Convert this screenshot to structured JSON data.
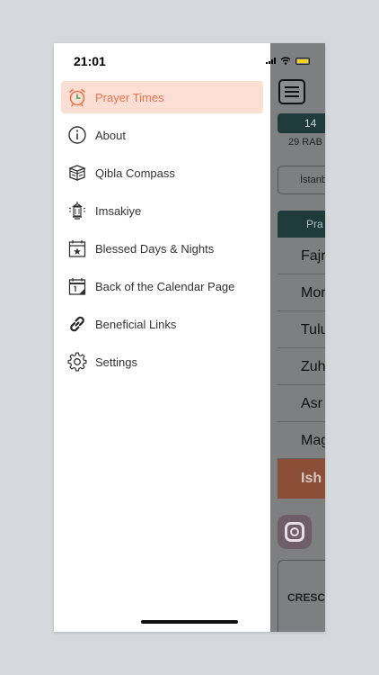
{
  "status_bar": {
    "time": "21:01"
  },
  "background_app": {
    "date": "14",
    "hijri_date": "29 RAB",
    "city": "İstanb",
    "table_header": "Pra",
    "rows": [
      "Fajr",
      "Mor",
      "Tulu",
      "Zuh",
      "Asr",
      "Mag",
      "Ish"
    ],
    "card_text": "CRESC"
  },
  "drawer": {
    "items": [
      {
        "label": "Prayer Times",
        "icon": "alarm-clock-icon",
        "selected": true
      },
      {
        "label": "About",
        "icon": "info-icon"
      },
      {
        "label": "Qibla Compass",
        "icon": "kaaba-icon"
      },
      {
        "label": "Imsakiye",
        "icon": "lantern-icon"
      },
      {
        "label": "Blessed Days & Nights",
        "icon": "calendar-star-icon"
      },
      {
        "label": "Back of the Calendar Page",
        "icon": "calendar-page-icon"
      },
      {
        "label": "Beneficial Links",
        "icon": "link-icon"
      },
      {
        "label": "Settings",
        "icon": "gear-icon"
      }
    ]
  },
  "colors": {
    "accent": "#e8754e",
    "selected_bg": "#fcded4",
    "header_dark": "#1e3a3a"
  }
}
